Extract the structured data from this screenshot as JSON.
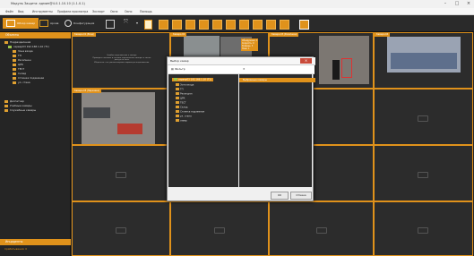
{
  "window": {
    "title": "Модуль Защита: админ@4.0.1.10.10 (1.1.0.1)"
  },
  "menu": [
    "Файл",
    "Вид",
    "Инструменты",
    "Профили просмотра",
    "Экспорт",
    "Окна",
    "Окно",
    "Помощь"
  ],
  "toolbar": {
    "layouts_label": "Обзор камер",
    "archive_label": "Архив",
    "settings_label": "Конфигурация"
  },
  "sidebar": {
    "header": "Объекты",
    "items": [
      "Подразделения",
      "сервер03 192.168.1.10 (T1)",
      "Зона входа",
      "ТП",
      "Ресепшен",
      "ЦРК",
      "ТЕСТ",
      "Склад",
      "Стоянка подземная",
      "ул. стана",
      "Диспетчер",
      "Учебные камеры",
      "Служебные камеры"
    ],
    "footer_header": "Инциденты",
    "footer_items": [
      "Срабатывания: 0"
    ]
  },
  "cameras": [
    {
      "label": "Камера 01 (Вход)"
    },
    {
      "label": "Камера 02"
    },
    {
      "label": "Камера 03 (Ресепшен)"
    },
    {
      "label": "Камера 04"
    },
    {
      "label": "Камера 05 (Парковка)"
    }
  ],
  "no_signal": {
    "line1": "Ошибка подключения к камере.",
    "line2": "Проверьте питание и сетевое подключение камеры, а также доступ по сети.",
    "line3": "Убедитесь, что указаны верные параметры подключения."
  },
  "overlay": {
    "l1": "Обнаружено: 1",
    "l2": "Скорость: 0",
    "l3": "Уровень: 3",
    "l4": "Зона: 1"
  },
  "dialog": {
    "title": "Выбор камер",
    "toolbar_label": "Фильтр",
    "tree": [
      "сервер03 192.168.1.10 (T1)",
      "Зона входа",
      "ТП",
      "Ресепшен",
      "ЦРК",
      "ТЕСТ",
      "Склад",
      "Стоянка подземная",
      "ул. стана",
      "север"
    ],
    "selected": "Выбранные камеры",
    "ok": "ОК",
    "cancel": "Отмена"
  }
}
